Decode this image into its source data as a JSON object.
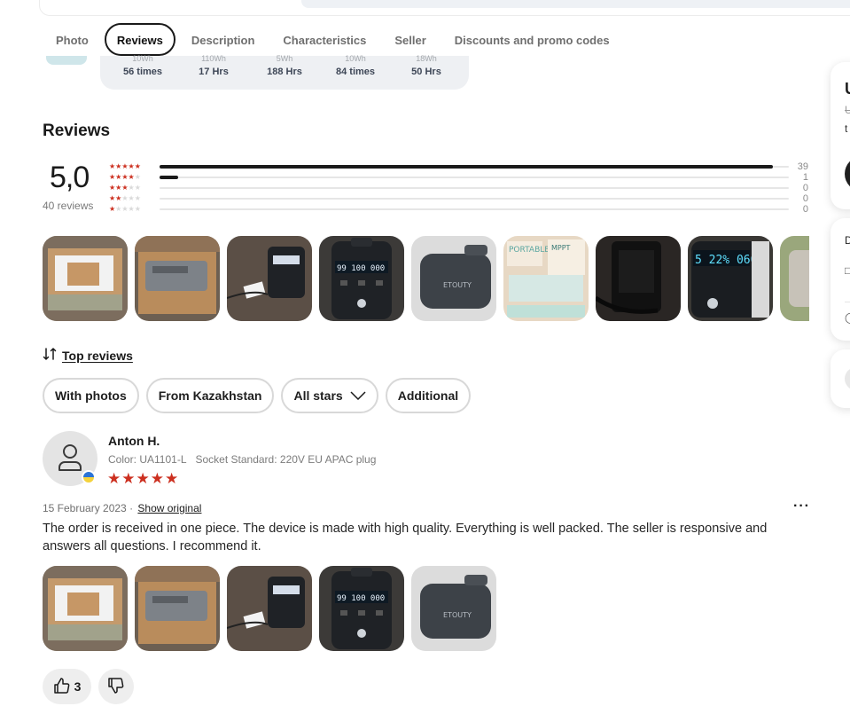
{
  "tabs": [
    {
      "label": "Photo",
      "active": false
    },
    {
      "label": "Reviews",
      "active": true
    },
    {
      "label": "Description",
      "active": false
    },
    {
      "label": "Characteristics",
      "active": false
    },
    {
      "label": "Seller",
      "active": false
    },
    {
      "label": "Discounts and promo codes",
      "active": false
    }
  ],
  "usage_stats": [
    {
      "label": "10Wh",
      "value": "56 times"
    },
    {
      "label": "110Wh",
      "value": "17 Hrs"
    },
    {
      "label": "5Wh",
      "value": "188 Hrs"
    },
    {
      "label": "10Wh",
      "value": "84 times"
    },
    {
      "label": "18Wh",
      "value": "50 Hrs"
    }
  ],
  "reviews": {
    "title": "Reviews",
    "average": "5,0",
    "count_label": "40 reviews",
    "distribution": [
      {
        "stars": 5,
        "count": "39",
        "fraction": 0.975
      },
      {
        "stars": 4,
        "count": "1",
        "fraction": 0.03
      },
      {
        "stars": 3,
        "count": "0",
        "fraction": 0
      },
      {
        "stars": 2,
        "count": "0",
        "fraction": 0
      },
      {
        "stars": 1,
        "count": "0",
        "fraction": 0
      }
    ],
    "sort_label": "Top reviews",
    "filters": [
      "With photos",
      "From Kazakhstan",
      "All stars",
      "Additional"
    ]
  },
  "review": {
    "author": "Anton H.",
    "color": "Color: UA1101-L",
    "socket": "Socket Standard: 220V EU APAC plug",
    "rating": 5,
    "date": "15 February 2023 ·",
    "show_original": "Show original",
    "text": "The order is received in one piece. The device is made with high quality. Everything is well packed. The seller is responsive and answers all questions. I recommend it.",
    "likes": "3",
    "more_label": "···"
  },
  "right_panel": {
    "title_fragment": "U",
    "old_price_fragment": "U",
    "line_fragment": "t",
    "section_fragment": "D"
  },
  "colors": {
    "accent_star": "#cc2f1f",
    "dark": "#1a1a1a",
    "chip_border": "#d8d8d8",
    "stats_bg": "#eef0f3"
  }
}
